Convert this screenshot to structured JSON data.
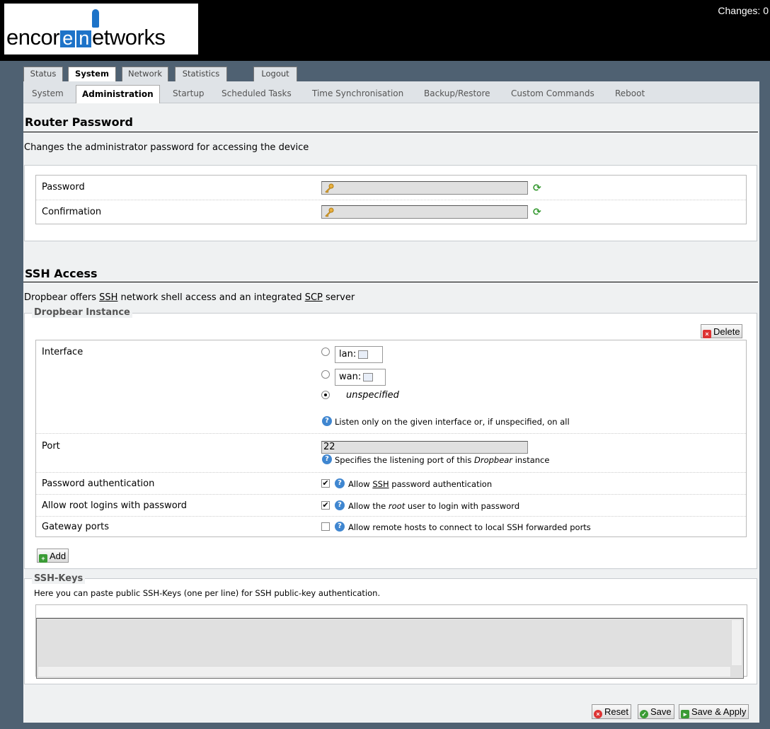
{
  "header": {
    "logo_left": "encor",
    "logo_e": "e",
    "logo_n": "n",
    "logo_right": "etworks",
    "changes": "Changes: 0"
  },
  "tabs": [
    {
      "label": "Status",
      "active": false
    },
    {
      "label": "System",
      "active": true
    },
    {
      "label": "Network",
      "active": false
    },
    {
      "label": "Statistics",
      "active": false
    },
    {
      "label": "Logout",
      "active": false
    }
  ],
  "subnav": [
    {
      "label": "System",
      "active": false
    },
    {
      "label": "Administration",
      "active": true
    },
    {
      "label": "Startup",
      "active": false
    },
    {
      "label": "Scheduled Tasks",
      "active": false
    },
    {
      "label": "Time Synchronisation",
      "active": false
    },
    {
      "label": "Backup/Restore",
      "active": false
    },
    {
      "label": "Custom Commands",
      "active": false
    },
    {
      "label": "Reboot",
      "active": false
    }
  ],
  "router_password": {
    "title": "Router Password",
    "description": "Changes the administrator password for accessing the device",
    "password_label": "Password",
    "password_value": "",
    "confirmation_label": "Confirmation",
    "confirmation_value": ""
  },
  "ssh": {
    "title": "SSH Access",
    "desc_1": "Dropbear offers ",
    "desc_ssh": "SSH",
    "desc_2": " network shell access and an integrated ",
    "desc_scp": "SCP",
    "desc_3": " server",
    "instance_legend": "Dropbear Instance",
    "delete_label": "Delete",
    "interface_label": "Interface",
    "interface_options": [
      "lan:",
      "wan:",
      "unspecified"
    ],
    "interface_selected": "unspecified",
    "interface_help": "Listen only on the given interface or, if unspecified, on all",
    "port_label": "Port",
    "port_value": "22",
    "port_help_1": "Specifies the listening port of this ",
    "port_help_em": "Dropbear",
    "port_help_2": " instance",
    "pwauth_label": "Password authentication",
    "pwauth_checked": true,
    "pwauth_help_1": "Allow ",
    "pwauth_help_ssh": "SSH",
    "pwauth_help_2": " password authentication",
    "root_label": "Allow root logins with password",
    "root_checked": true,
    "root_help_1": "Allow the ",
    "root_help_em": "root",
    "root_help_2": " user to login with password",
    "gw_label": "Gateway ports",
    "gw_checked": false,
    "gw_help": "Allow remote hosts to connect to local SSH forwarded ports",
    "add_label": "Add"
  },
  "ssh_keys": {
    "legend": "SSH-Keys",
    "description": "Here you can paste public SSH-Keys (one per line) for SSH public-key authentication.",
    "value": ""
  },
  "footer": {
    "reset": "Reset",
    "save": "Save",
    "save_apply": "Save & Apply"
  },
  "colors": {
    "header_bg": "#000000",
    "page_bg": "#4f6172",
    "content_bg": "#eff1f2",
    "brand_blue": "#1d73c8"
  }
}
